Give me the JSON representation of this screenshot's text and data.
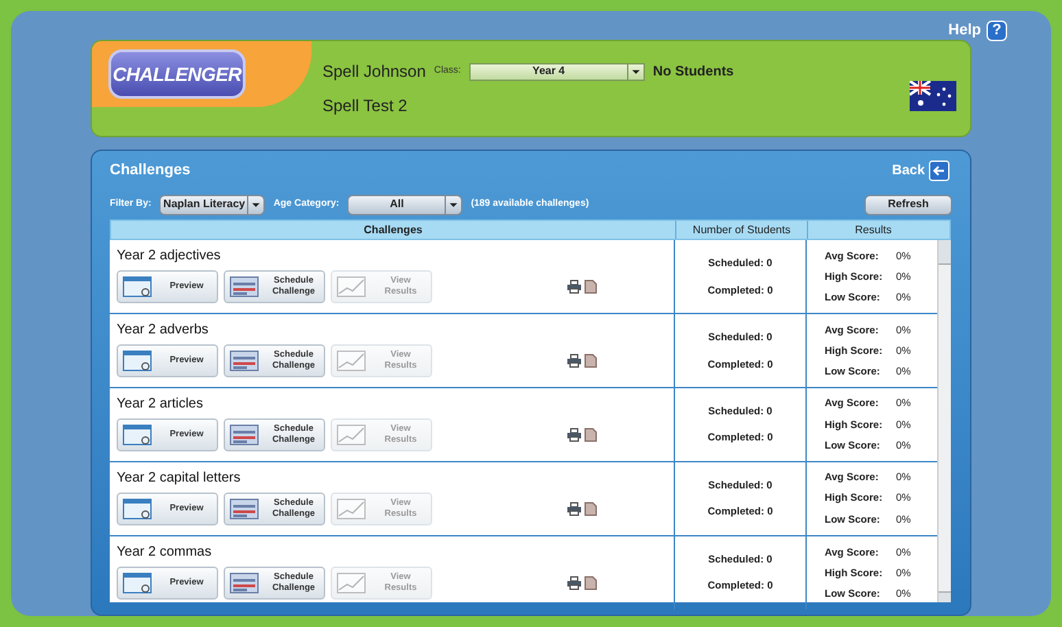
{
  "help": {
    "label": "Help",
    "icon": "?"
  },
  "header": {
    "logo": "CHALLENGER",
    "user": "Spell Johnson",
    "class_label": "Class:",
    "class_value": "Year 4",
    "students": "No Students",
    "test": "Spell Test 2"
  },
  "panel": {
    "title": "Challenges",
    "back": "Back"
  },
  "filters": {
    "filter_label": "Filter By:",
    "filter_value": "Naplan Literacy",
    "age_label": "Age Category:",
    "age_value": "All",
    "count": "(189 available challenges)",
    "refresh": "Refresh"
  },
  "table": {
    "columns": [
      "Challenges",
      "Number of Students",
      "Results"
    ],
    "rows": [
      {
        "name": "Year 2 adjectives",
        "buttons": [
          {
            "kind": "preview",
            "label": "Preview",
            "disabled": false
          },
          {
            "kind": "schedule",
            "label": "Schedule Challenge",
            "disabled": false
          },
          {
            "kind": "results",
            "label": "View Results",
            "disabled": true
          }
        ],
        "scheduled": "Scheduled: 0",
        "completed": "Completed: 0",
        "scores": [
          {
            "label": "Avg Score:",
            "value": "0%"
          },
          {
            "label": "High Score:",
            "value": "0%"
          },
          {
            "label": "Low Score:",
            "value": "0%"
          }
        ]
      },
      {
        "name": "Year 2 adverbs",
        "buttons": [
          {
            "kind": "preview",
            "label": "Preview",
            "disabled": false
          },
          {
            "kind": "schedule",
            "label": "Schedule Challenge",
            "disabled": false
          },
          {
            "kind": "results",
            "label": "View Results",
            "disabled": true
          }
        ],
        "scheduled": "Scheduled: 0",
        "completed": "Completed: 0",
        "scores": [
          {
            "label": "Avg Score:",
            "value": "0%"
          },
          {
            "label": "High Score:",
            "value": "0%"
          },
          {
            "label": "Low Score:",
            "value": "0%"
          }
        ]
      },
      {
        "name": "Year 2 articles",
        "buttons": [
          {
            "kind": "preview",
            "label": "Preview",
            "disabled": false
          },
          {
            "kind": "schedule",
            "label": "Schedule Challenge",
            "disabled": false
          },
          {
            "kind": "results",
            "label": "View Results",
            "disabled": true
          }
        ],
        "scheduled": "Scheduled: 0",
        "completed": "Completed: 0",
        "scores": [
          {
            "label": "Avg Score:",
            "value": "0%"
          },
          {
            "label": "High Score:",
            "value": "0%"
          },
          {
            "label": "Low Score:",
            "value": "0%"
          }
        ]
      },
      {
        "name": "Year 2 capital letters",
        "buttons": [
          {
            "kind": "preview",
            "label": "Preview",
            "disabled": false
          },
          {
            "kind": "schedule",
            "label": "Schedule Challenge",
            "disabled": false
          },
          {
            "kind": "results",
            "label": "View Results",
            "disabled": true
          }
        ],
        "scheduled": "Scheduled: 0",
        "completed": "Completed: 0",
        "scores": [
          {
            "label": "Avg Score:",
            "value": "0%"
          },
          {
            "label": "High Score:",
            "value": "0%"
          },
          {
            "label": "Low Score:",
            "value": "0%"
          }
        ]
      },
      {
        "name": "Year 2 commas",
        "buttons": [
          {
            "kind": "preview",
            "label": "Preview",
            "disabled": false
          },
          {
            "kind": "schedule",
            "label": "Schedule Challenge",
            "disabled": false
          },
          {
            "kind": "results",
            "label": "View Results",
            "disabled": true
          }
        ],
        "scheduled": "Scheduled: 0",
        "completed": "Completed: 0",
        "scores": [
          {
            "label": "Avg Score:",
            "value": "0%"
          },
          {
            "label": "High Score:",
            "value": "0%"
          },
          {
            "label": "Low Score:",
            "value": "0%"
          }
        ]
      }
    ]
  }
}
